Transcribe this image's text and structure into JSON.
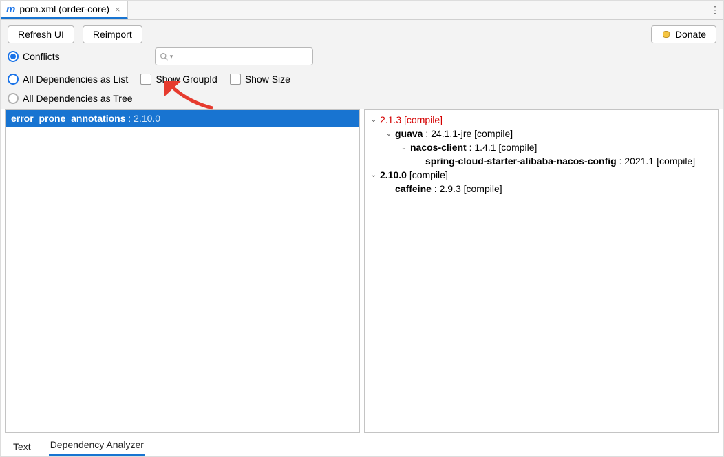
{
  "tab": {
    "title": "pom.xml (order-core)"
  },
  "toolbar": {
    "refresh": "Refresh UI",
    "reimport": "Reimport",
    "donate": "Donate"
  },
  "options": {
    "conflicts": "Conflicts",
    "all_list": "All Dependencies as List",
    "all_tree": "All Dependencies as Tree",
    "show_groupid": "Show GroupId",
    "show_size": "Show Size",
    "search_placeholder": ""
  },
  "left": {
    "items": [
      {
        "name": "error_prone_annotations",
        "version": "2.10.0"
      }
    ]
  },
  "tree": [
    {
      "depth": 0,
      "expand": "open",
      "label": "2.1.3 [compile]",
      "red": true,
      "bold": false
    },
    {
      "depth": 1,
      "expand": "open",
      "name": "guava",
      "rest": " : 24.1.1-jre [compile]"
    },
    {
      "depth": 2,
      "expand": "open",
      "name": "nacos-client",
      "rest": " : 1.4.1 [compile]"
    },
    {
      "depth": 3,
      "expand": "none",
      "name": "spring-cloud-starter-alibaba-nacos-config",
      "rest": " : 2021.1 [compile]"
    },
    {
      "depth": 0,
      "expand": "open",
      "name": "2.10.0",
      "rest": " [compile]"
    },
    {
      "depth": 1,
      "expand": "none",
      "name": "caffeine",
      "rest": " : 2.9.3 [compile]"
    }
  ],
  "bottom_tabs": {
    "text": "Text",
    "analyzer": "Dependency Analyzer"
  }
}
